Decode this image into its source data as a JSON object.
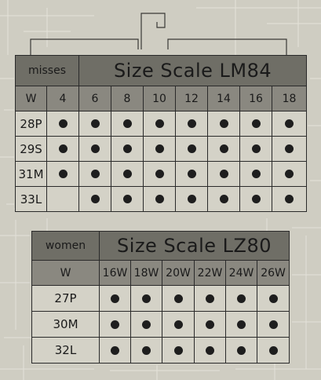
{
  "misses": {
    "category": "misses",
    "title": "Size Scale LM84",
    "waist_label": "W",
    "sizes": [
      "4",
      "6",
      "8",
      "10",
      "12",
      "14",
      "16",
      "18"
    ],
    "rows": [
      {
        "label": "28P",
        "avail": [
          true,
          true,
          true,
          true,
          true,
          true,
          true,
          true
        ]
      },
      {
        "label": "29S",
        "avail": [
          true,
          true,
          true,
          true,
          true,
          true,
          true,
          true
        ]
      },
      {
        "label": "31M",
        "avail": [
          true,
          true,
          true,
          true,
          true,
          true,
          true,
          true
        ]
      },
      {
        "label": "33L",
        "avail": [
          false,
          true,
          true,
          true,
          true,
          true,
          true,
          true
        ]
      }
    ]
  },
  "women": {
    "category": "women",
    "title": "Size Scale LZ80",
    "waist_label": "W",
    "sizes": [
      "16W",
      "18W",
      "20W",
      "22W",
      "24W",
      "26W"
    ],
    "rows": [
      {
        "label": "27P",
        "avail": [
          true,
          true,
          true,
          true,
          true,
          true
        ]
      },
      {
        "label": "30M",
        "avail": [
          true,
          true,
          true,
          true,
          true,
          true
        ]
      },
      {
        "label": "32L",
        "avail": [
          true,
          true,
          true,
          true,
          true,
          true
        ]
      }
    ]
  }
}
